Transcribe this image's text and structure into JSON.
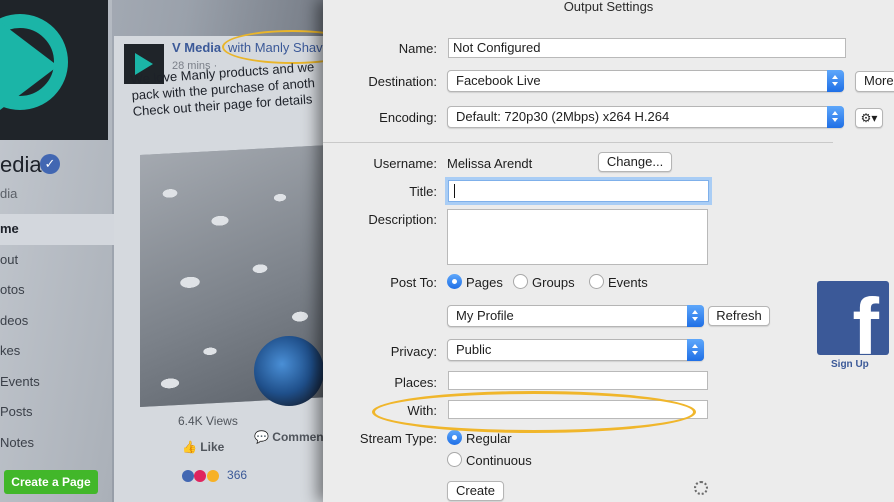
{
  "background_page": {
    "page_name": "edia",
    "handle": "dia",
    "nav_items": [
      "me",
      "out",
      "otos",
      "deos",
      "kes",
      "Events",
      "Posts",
      "Notes"
    ],
    "create_page_label": "Create a Page",
    "post": {
      "author": "V Media",
      "with_text": "with Manly Shav",
      "time": "28 mins ·",
      "text": "We love Manly products and we pack with the purchase of anoth Check out their page for details",
      "views": "6.4K Views",
      "like_label": "Like",
      "comment_label": "Comment",
      "reaction_count": "366"
    }
  },
  "dialog": {
    "title": "Output Settings",
    "name_label": "Name:",
    "name_value": "Not Configured",
    "destination_label": "Destination:",
    "destination_value": "Facebook Live",
    "more_label": "More",
    "encoding_label": "Encoding:",
    "encoding_value": "Default: 720p30 (2Mbps) x264 H.264",
    "gear_icon": "⚙▾",
    "username_label": "Username:",
    "username_value": "Melissa Arendt",
    "change_label": "Change...",
    "title_label": "Title:",
    "title_value": "",
    "description_label": "Description:",
    "description_value": "",
    "post_to_label": "Post To:",
    "post_to_options": [
      "Pages",
      "Groups",
      "Events"
    ],
    "post_to_selected": "Pages",
    "profile_value": "My Profile",
    "refresh_label": "Refresh",
    "privacy_label": "Privacy:",
    "privacy_value": "Public",
    "places_label": "Places:",
    "places_value": "",
    "with_label": "With:",
    "with_value": "",
    "stream_type_label": "Stream Type:",
    "stream_type_options": [
      "Regular",
      "Continuous"
    ],
    "stream_type_selected": "Regular",
    "create_label": "Create"
  },
  "facebook_badge": {
    "letter": "f",
    "signup_label": "Sign Up"
  },
  "colors": {
    "facebook_blue": "#3b5998",
    "highlight_ring": "#f0b62b",
    "focus_ring": "#a9cdf5",
    "mac_blue": "#1f6fe6"
  }
}
